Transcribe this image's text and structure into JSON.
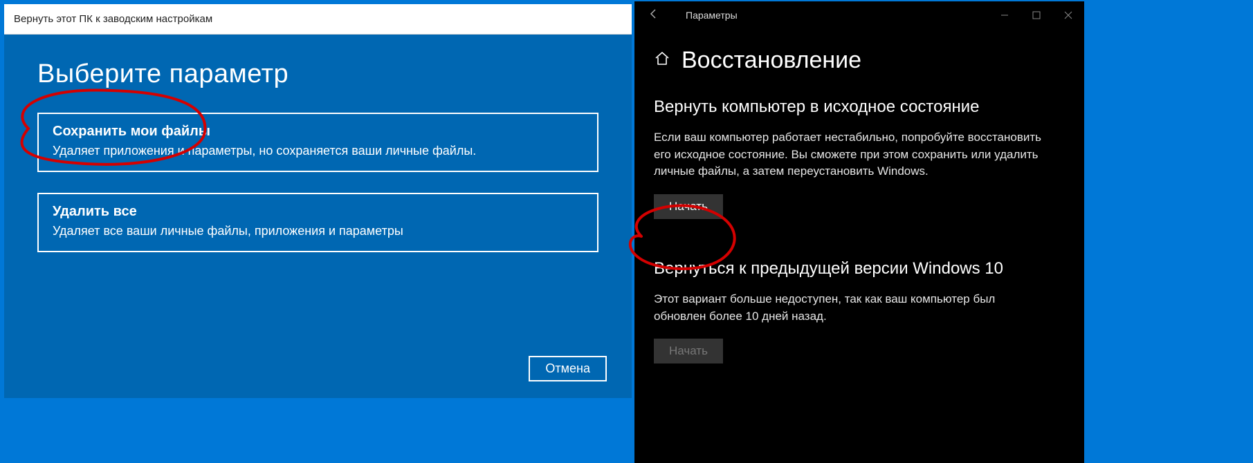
{
  "reset": {
    "titlebar": "Вернуть этот ПК к заводским настройкам",
    "heading": "Выберите параметр",
    "option1": {
      "title": "Сохранить мои файлы",
      "desc": "Удаляет приложения и параметры, но сохраняется ваши личные файлы."
    },
    "option2": {
      "title": "Удалить все",
      "desc": "Удаляет все ваши личные файлы, приложения и параметры"
    },
    "cancel": "Отмена"
  },
  "settings": {
    "window_title": "Параметры",
    "page_title": "Восстановление",
    "section1": {
      "heading": "Вернуть компьютер в исходное состояние",
      "text": "Если ваш компьютер работает нестабильно, попробуйте восстановить его исходное состояние. Вы сможете при этом сохранить или удалить личные файлы, а затем переустановить Windows.",
      "button": "Начать"
    },
    "section2": {
      "heading": "Вернуться к предыдущей версии Windows 10",
      "text": "Этот вариант больше недоступен, так как ваш компьютер был обновлен более 10 дней назад.",
      "button": "Начать"
    }
  }
}
